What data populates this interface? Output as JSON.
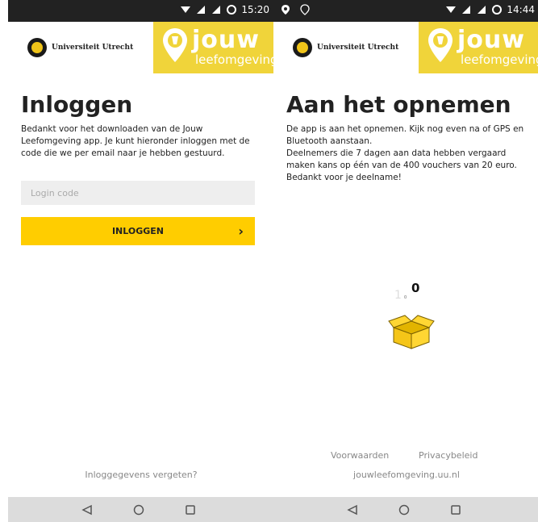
{
  "left_screen": {
    "status_bar": {
      "time": "15:20"
    },
    "header": {
      "university_name": "Universiteit Utrecht",
      "brand_word": "jouw",
      "brand_sub": "leefomgeving"
    },
    "title": "Inloggen",
    "description": "Bedankt voor het downloaden van de Jouw Leefomgeving app. Je kunt hieronder inloggen met de code die we per email naar je hebben gestuurd.",
    "login_input": {
      "placeholder": "Login code",
      "value": ""
    },
    "login_button": {
      "label": "INLOGGEN",
      "arrow": "›"
    },
    "forgot_link": "Inloggegevens vergeten?"
  },
  "right_screen": {
    "status_bar": {
      "time": "14:44"
    },
    "header": {
      "university_name": "Universiteit Utrecht",
      "brand_word": "jouw",
      "brand_sub": "leefomgeving"
    },
    "title": "Aan het opnemen",
    "description_lines": [
      "De app is aan het opnemen. Kijk nog even na of GPS en Bluetooth aanstaan.",
      "Deelnemers die 7 dagen aan data hebben vergaard maken kans op één van de 400 vouchers van 20 euro.",
      "Bedankt voor je deelname!"
    ],
    "counter": {
      "ghost": "1",
      "small": "0",
      "value": "0"
    },
    "footer": {
      "terms": "Voorwaarden",
      "privacy": "Privacybeleid",
      "site": "jouwleefomgeving.uu.nl"
    }
  },
  "icons": [
    "wifi-icon",
    "signal-icon",
    "sync-icon",
    "location-icon",
    "pin-icon",
    "back-icon",
    "home-icon",
    "recent-apps-icon",
    "box-icon"
  ],
  "colors": {
    "accent": "#ffcd00",
    "brand_bg": "#f0d43a",
    "status_bar": "#222222",
    "nav_bar": "#dcdcdc"
  }
}
